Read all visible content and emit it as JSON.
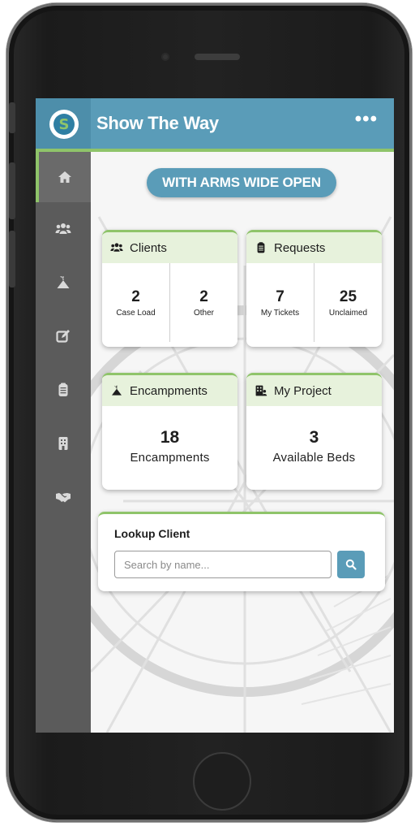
{
  "app": {
    "title": "Show The Way",
    "logo_letter": "S",
    "more_label": "•••",
    "tagline": "WITH ARMS WIDE OPEN"
  },
  "sidebar": {
    "items": [
      {
        "icon": "home-icon",
        "active": true
      },
      {
        "icon": "users-icon"
      },
      {
        "icon": "tent-icon"
      },
      {
        "icon": "edit-icon"
      },
      {
        "icon": "clipboard-icon"
      },
      {
        "icon": "building-icon"
      },
      {
        "icon": "handshake-icon"
      }
    ]
  },
  "cards": {
    "clients": {
      "title": "Clients",
      "stats": [
        {
          "value": "2",
          "label": "Case Load"
        },
        {
          "value": "2",
          "label": "Other"
        }
      ]
    },
    "requests": {
      "title": "Requests",
      "stats": [
        {
          "value": "7",
          "label": "My Tickets"
        },
        {
          "value": "25",
          "label": "Unclaimed"
        }
      ]
    },
    "encampments": {
      "title": "Encampments",
      "value": "18",
      "label": "Encampments"
    },
    "project": {
      "title": "My Project",
      "value": "3",
      "label": "Available Beds"
    }
  },
  "lookup": {
    "title": "Lookup Client",
    "placeholder": "Search by name..."
  },
  "colors": {
    "primary": "#5a9cb8",
    "accent": "#8fc46a",
    "sidebar": "#5b5b5b",
    "card_header": "#e7f2dc"
  }
}
